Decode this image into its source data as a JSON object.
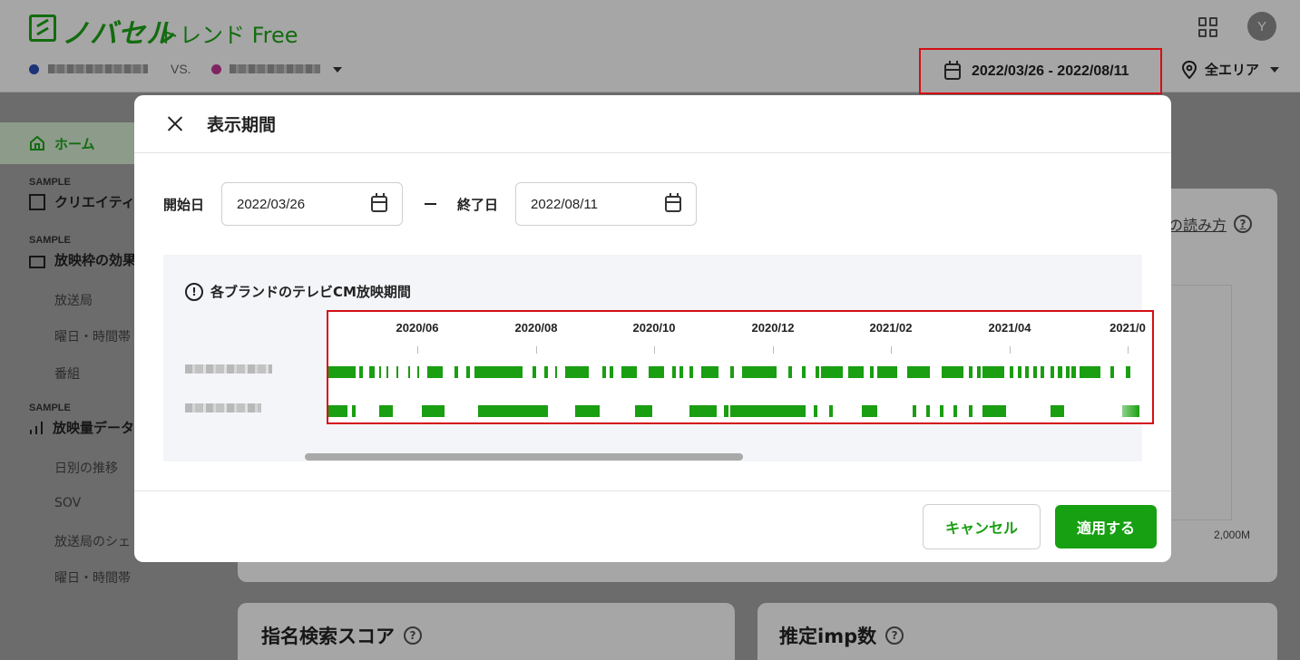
{
  "header": {
    "logo_name": "ノバセル",
    "logo_sub": "トレンド Free",
    "avatar_initial": "Y",
    "vs_label": "VS.",
    "brand_colors": [
      "#2b4fb8",
      "#c43a9a"
    ],
    "date_range": "2022/03/26 - 2022/08/11",
    "area": "全エリア"
  },
  "sidebar": {
    "home": "ホーム",
    "sample_label": "SAMPLE",
    "sections": [
      {
        "title": "クリエイティ",
        "items": []
      },
      {
        "title": "放映枠の効果",
        "items": [
          "放送局",
          "曜日・時間帯",
          "番組"
        ]
      },
      {
        "title": "放映量データ",
        "items": [
          "日別の推移",
          "SOV",
          "放送局のシェ",
          "曜日・時間帯"
        ]
      }
    ]
  },
  "background": {
    "guide_link": "の読み方",
    "axis_value": "2,000M",
    "card1_title": "指名検索スコア",
    "card2_title": "推定imp数"
  },
  "modal": {
    "title": "表示期間",
    "start_label": "開始日",
    "start_value": "2022/03/26",
    "end_label": "終了日",
    "end_value": "2022/08/11",
    "period_title": "各ブランドのテレビCM放映期間",
    "cancel": "キャンセル",
    "apply": "適用する",
    "accent_color": "#17a012",
    "highlight_color": "#d40f14"
  },
  "chart_data": {
    "type": "timeline",
    "months": [
      "2020/06",
      "2020/08",
      "2020/10",
      "2020/12",
      "2021/02",
      "2021/04",
      "2021/0"
    ],
    "series": [
      {
        "segments": [
          [
            "2020-04-23",
            "2020-05-07"
          ],
          [
            "2020-05-09",
            "2020-05-11"
          ],
          [
            "2020-05-14",
            "2020-05-17"
          ],
          [
            "2020-05-19",
            "2020-05-20"
          ],
          [
            "2020-05-23",
            "2020-05-24"
          ],
          [
            "2020-05-28",
            "2020-05-29"
          ],
          [
            "2020-06-03",
            "2020-06-04"
          ],
          [
            "2020-06-08",
            "2020-06-09"
          ],
          [
            "2020-06-13",
            "2020-06-21"
          ],
          [
            "2020-06-27",
            "2020-06-29"
          ],
          [
            "2020-07-03",
            "2020-07-05"
          ],
          [
            "2020-07-07",
            "2020-08-01"
          ],
          [
            "2020-08-06",
            "2020-08-08"
          ],
          [
            "2020-08-12",
            "2020-08-14"
          ],
          [
            "2020-08-18",
            "2020-08-19"
          ],
          [
            "2020-08-23",
            "2020-09-04"
          ],
          [
            "2020-09-11",
            "2020-09-13"
          ],
          [
            "2020-09-15",
            "2020-09-17"
          ],
          [
            "2020-09-21",
            "2020-09-29"
          ],
          [
            "2020-10-05",
            "2020-10-13"
          ],
          [
            "2020-10-17",
            "2020-10-19"
          ],
          [
            "2020-10-21",
            "2020-10-23"
          ],
          [
            "2020-10-26",
            "2020-10-28"
          ],
          [
            "2020-11-01",
            "2020-11-10"
          ],
          [
            "2020-11-16",
            "2020-11-18"
          ],
          [
            "2020-11-22",
            "2020-12-10"
          ],
          [
            "2020-12-16",
            "2020-12-18"
          ],
          [
            "2020-12-23",
            "2020-12-25"
          ],
          [
            "2020-12-30",
            "2021-01-01"
          ],
          [
            "2021-01-02",
            "2021-01-13"
          ],
          [
            "2021-01-16",
            "2021-01-24"
          ],
          [
            "2021-01-27",
            "2021-01-29"
          ],
          [
            "2021-01-31",
            "2021-02-10"
          ],
          [
            "2021-02-15",
            "2021-02-27"
          ],
          [
            "2021-03-05",
            "2021-03-16"
          ],
          [
            "2021-03-19",
            "2021-03-21"
          ],
          [
            "2021-03-23",
            "2021-03-25"
          ],
          [
            "2021-03-26",
            "2021-04-06"
          ],
          [
            "2021-04-09",
            "2021-04-11"
          ],
          [
            "2021-04-13",
            "2021-04-15"
          ],
          [
            "2021-04-17",
            "2021-04-19"
          ],
          [
            "2021-04-21",
            "2021-04-23"
          ],
          [
            "2021-04-25",
            "2021-04-27"
          ],
          [
            "2021-04-30",
            "2021-05-02"
          ],
          [
            "2021-05-04",
            "2021-05-06"
          ],
          [
            "2021-05-08",
            "2021-05-10"
          ],
          [
            "2021-05-11",
            "2021-05-13"
          ],
          [
            "2021-05-15",
            "2021-05-26"
          ],
          [
            "2021-05-31",
            "2021-06-02"
          ],
          [
            "2021-06-08",
            "2021-06-10"
          ]
        ]
      },
      {
        "segments": [
          [
            "2020-04-23",
            "2020-05-03"
          ],
          [
            "2020-05-05",
            "2020-05-07"
          ],
          [
            "2020-05-19",
            "2020-05-26"
          ],
          [
            "2020-06-10",
            "2020-06-22"
          ],
          [
            "2020-07-09",
            "2020-08-14"
          ],
          [
            "2020-08-28",
            "2020-09-10"
          ],
          [
            "2020-09-28",
            "2020-10-07"
          ],
          [
            "2020-10-26",
            "2020-11-09"
          ],
          [
            "2020-11-13",
            "2020-11-15"
          ],
          [
            "2020-11-16",
            "2020-12-25"
          ],
          [
            "2020-12-29",
            "2020-12-31"
          ],
          [
            "2021-01-06",
            "2021-01-08"
          ],
          [
            "2021-01-23",
            "2021-01-31"
          ],
          [
            "2021-02-18",
            "2021-02-20"
          ],
          [
            "2021-02-25",
            "2021-02-27"
          ],
          [
            "2021-03-04",
            "2021-03-06"
          ],
          [
            "2021-03-11",
            "2021-03-13"
          ],
          [
            "2021-03-19",
            "2021-03-21"
          ],
          [
            "2021-03-26",
            "2021-04-07"
          ],
          [
            "2021-04-30",
            "2021-05-07"
          ],
          [
            "2021-06-06",
            "2021-06-15"
          ]
        ]
      }
    ]
  }
}
